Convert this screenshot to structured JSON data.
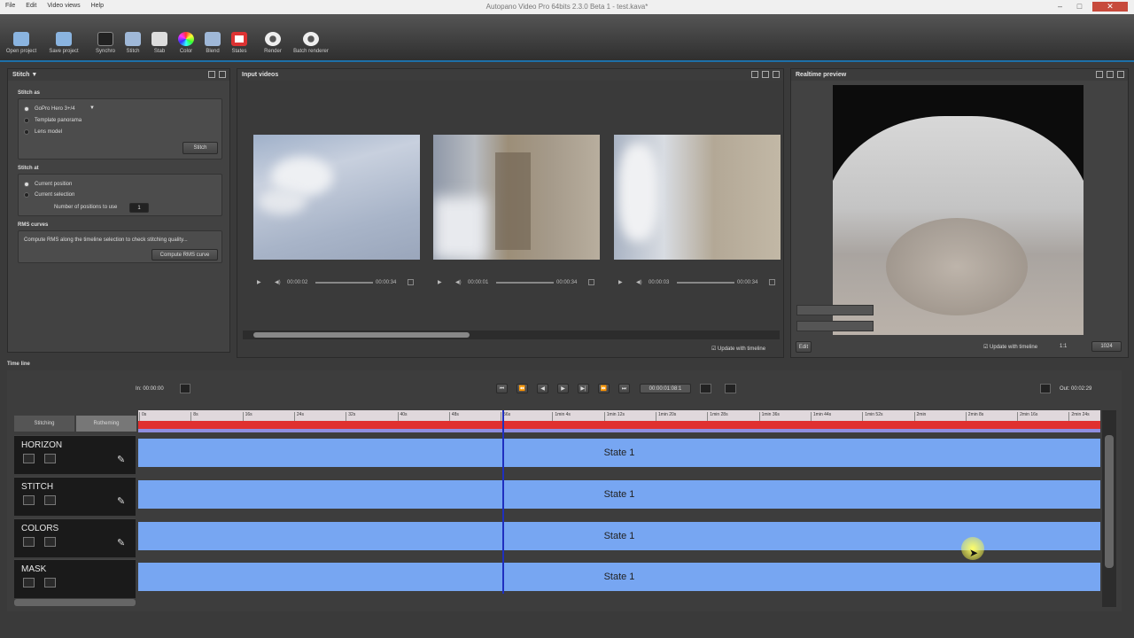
{
  "window": {
    "title": "Autopano Video Pro 64bits 2.3.0 Beta 1 - test.kava*",
    "minimize": "–",
    "maximize": "□",
    "close": "✕"
  },
  "menu": [
    "File",
    "Edit",
    "Video views",
    "Help"
  ],
  "toolbar": {
    "items": [
      {
        "label": "Open project",
        "icon": "folder-icon"
      },
      {
        "label": "Save project",
        "icon": "save-icon"
      },
      {
        "label": "Synchro",
        "icon": "clapper-icon"
      },
      {
        "label": "Stitch",
        "icon": "stitch-icon"
      },
      {
        "label": "Stab",
        "icon": "stab-icon"
      },
      {
        "label": "Color",
        "icon": "color-wheel-icon"
      },
      {
        "label": "Blend",
        "icon": "blend-icon"
      },
      {
        "label": "States",
        "icon": "states-icon"
      },
      {
        "label": "Render",
        "icon": "gear-icon"
      },
      {
        "label": "Batch renderer",
        "icon": "gear-icon"
      }
    ]
  },
  "stitch_panel": {
    "title": "Stitch",
    "stitch_as_label": "Stitch as",
    "preset": "GoPro Hero 3+/4",
    "template": "Template panorama",
    "lens": "Lens model",
    "stitch_button": "Stitch",
    "stitch_at_label": "Stitch at",
    "current_position": "Current position",
    "current_selection": "Current selection",
    "positions_label": "Number of positions to use",
    "positions_value": "1",
    "rms_label": "RMS curves",
    "rms_text": "Compute RMS along the timeline selection to check stitching quality...",
    "rms_button": "Compute RMS curve"
  },
  "input_panel": {
    "title": "Input videos",
    "update_label": "Update with timeline",
    "videos": [
      {
        "time": "00:00:02",
        "end": "00:00:34"
      },
      {
        "time": "00:00:01",
        "end": "00:00:34"
      },
      {
        "time": "00:00:03",
        "end": "00:00:34"
      }
    ]
  },
  "preview_panel": {
    "title": "Realtime preview",
    "edit_button": "Edit",
    "update_label": "Update with timeline",
    "zoom_text": "1:1",
    "size_value": "1024"
  },
  "timeline": {
    "title": "Time line",
    "in_label": "In: 00:00:00",
    "out_label": "Out: 00:02:29",
    "time_value": "00:00:01:08:1",
    "tabs": [
      "Stitching",
      "Rotheming"
    ],
    "ticks": [
      "0s",
      "8s",
      "16s",
      "24s",
      "32s",
      "40s",
      "48s",
      "56s",
      "1min 4s",
      "1min 12s",
      "1min 20s",
      "1min 28s",
      "1min 36s",
      "1min 44s",
      "1min 52s",
      "2min",
      "2min 8s",
      "2min 16s",
      "2min 24s"
    ],
    "tracks": [
      {
        "name": "HORIZON",
        "state": "State 1"
      },
      {
        "name": "STITCH",
        "state": "State 1"
      },
      {
        "name": "COLORS",
        "state": "State 1"
      },
      {
        "name": "MASK",
        "state": "State 1"
      }
    ]
  },
  "colors": {
    "accent": "#1d6fa8",
    "track": "#77a6f2",
    "playhead": "#1f2fbf",
    "red_bar": "#e03030"
  }
}
